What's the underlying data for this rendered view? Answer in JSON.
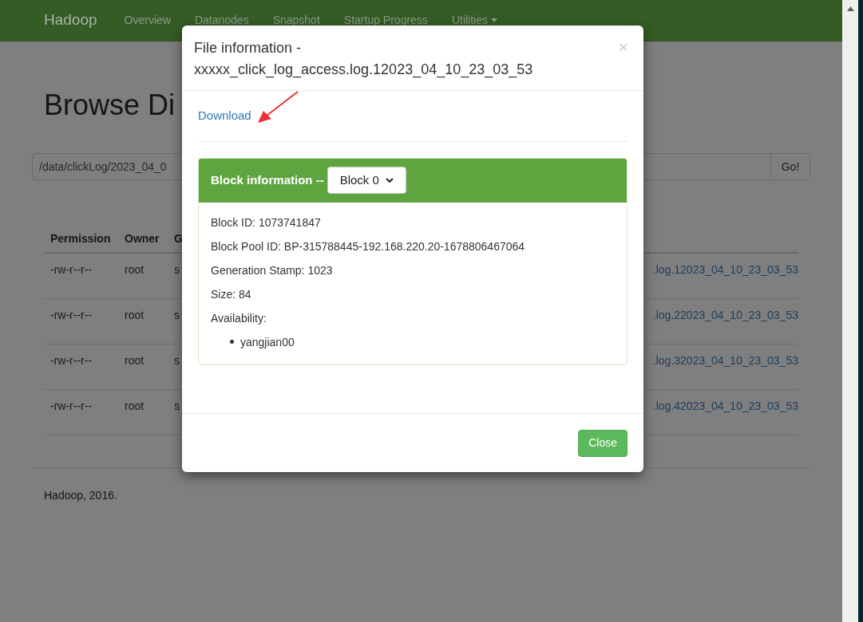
{
  "navbar": {
    "brand": "Hadoop",
    "items": [
      {
        "label": "Overview",
        "dropdown": false
      },
      {
        "label": "Datanodes",
        "dropdown": false
      },
      {
        "label": "Snapshot",
        "dropdown": false
      },
      {
        "label": "Startup Progress",
        "dropdown": false
      },
      {
        "label": "Utilities",
        "dropdown": true
      }
    ]
  },
  "page": {
    "heading": "Browse Di",
    "path_field": {
      "value": "/data/clickLog/2023_04_0"
    },
    "go_button": "Go!",
    "table": {
      "columns": [
        "Permission",
        "Owner",
        "G"
      ],
      "rows": [
        {
          "cells": [
            "-rw-r--r--",
            "root",
            "s"
          ],
          "name": ".log.12023_04_10_23_03_53"
        },
        {
          "cells": [
            "-rw-r--r--",
            "root",
            "s"
          ],
          "name": ".log.22023_04_10_23_03_53"
        },
        {
          "cells": [
            "-rw-r--r--",
            "root",
            "s"
          ],
          "name": ".log.32023_04_10_23_03_53"
        },
        {
          "cells": [
            "-rw-r--r--",
            "root",
            "s"
          ],
          "name": ".log.42023_04_10_23_03_53"
        }
      ]
    },
    "footer": "Hadoop, 2016."
  },
  "modal": {
    "title": [
      "File information -",
      "xxxxx_click_log_access.log.12023_04_10_23_03_53"
    ],
    "close_icon": "×",
    "download_link": "Download",
    "block_panel": {
      "label": "Block information --",
      "select": {
        "value": "Block 0"
      },
      "details": [
        "Block ID: 1073741847",
        "Block Pool ID: BP-315788445-192.168.220.20-1678806467064",
        "Generation Stamp: 1023",
        "Size: 84",
        "Availability:"
      ],
      "availability": [
        "yangjian00"
      ]
    },
    "close_button": "Close"
  }
}
